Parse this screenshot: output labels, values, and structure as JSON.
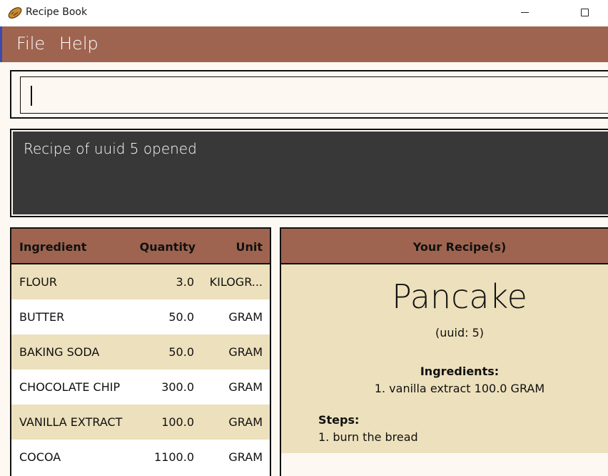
{
  "window": {
    "title": "Recipe Book",
    "icon": "bread-icon"
  },
  "menu": {
    "file": "File",
    "help": "Help"
  },
  "command": {
    "value": ""
  },
  "result": {
    "message": "Recipe of uuid 5 opened"
  },
  "ingredients_table": {
    "headers": {
      "ingredient": "Ingredient",
      "quantity": "Quantity",
      "unit": "Unit"
    },
    "rows": [
      {
        "ingredient": "FLOUR",
        "quantity": "3.0",
        "unit": "KILOGR..."
      },
      {
        "ingredient": "BUTTER",
        "quantity": "50.0",
        "unit": "GRAM"
      },
      {
        "ingredient": "BAKING SODA",
        "quantity": "50.0",
        "unit": "GRAM"
      },
      {
        "ingredient": "CHOCOLATE CHIP",
        "quantity": "300.0",
        "unit": "GRAM"
      },
      {
        "ingredient": "VANILLA EXTRACT",
        "quantity": "100.0",
        "unit": "GRAM"
      },
      {
        "ingredient": "COCOA",
        "quantity": "1100.0",
        "unit": "GRAM"
      }
    ]
  },
  "recipe_panel": {
    "header": "Your Recipe(s)",
    "name": "Pancake",
    "uuid": "(uuid: 5)",
    "ingredients_label": "Ingredients:",
    "ingredients": [
      "1. vanilla extract 100.0 GRAM"
    ],
    "steps_label": "Steps:",
    "steps": [
      "1. burn the bread"
    ]
  },
  "colors": {
    "accent": "#9e6450",
    "row_alt": "#ede0bc",
    "result_bg": "#383838",
    "background": "#fdf8f2"
  }
}
